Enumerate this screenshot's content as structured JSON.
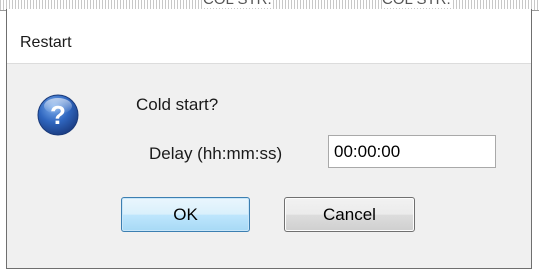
{
  "background": {
    "column_labels": [
      "COL STR.",
      "COL STR."
    ]
  },
  "dialog": {
    "title": "Restart",
    "icon": "question-icon",
    "message": "Cold start?",
    "delay_label": "Delay (hh:mm:ss)",
    "delay_value": "00:00:00",
    "ok_label": "OK",
    "cancel_label": "Cancel"
  },
  "colors": {
    "icon_blue": "#2a5fb0",
    "ok_border": "#3c7fb1"
  }
}
